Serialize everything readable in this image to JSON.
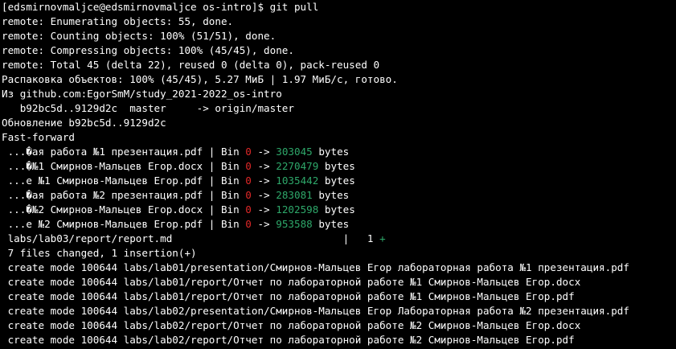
{
  "colors": {
    "background": "#000000",
    "text": "#ffffff",
    "removed": "#e02828",
    "added": "#2ea86a"
  },
  "prompt": {
    "text": "[edsmirnovmaljce@edsmirnovmaljce os-intro]$ ",
    "command": "git pull"
  },
  "output": [
    "remote: Enumerating objects: 55, done.",
    "remote: Counting objects: 100% (51/51), done.",
    "remote: Compressing objects: 100% (45/45), done.",
    "remote: Total 45 (delta 22), reused 0 (delta 0), pack-reused 0",
    "Распаковка объектов: 100% (45/45), 5.27 МиБ | 1.97 МиБ/с, готово.",
    "Из github.com:EgorSmM/study_2021-2022_os-intro",
    "   b92bc5d..9129d2c  master     -> origin/master",
    "Обновление b92bc5d..9129d2c",
    "Fast-forward"
  ],
  "binary_changes": [
    {
      "name": " ...�ая работа №1 презентация.pdf | Bin ",
      "from": "0",
      "arrow": " -> ",
      "to": "303045",
      "unit": " bytes"
    },
    {
      "name": " ...�№1 Смирнов-Мальцев Егор.docx | Bin ",
      "from": "0",
      "arrow": " -> ",
      "to": "2270479",
      "unit": " bytes"
    },
    {
      "name": " ...е №1 Смирнов-Мальцев Егор.pdf | Bin ",
      "from": "0",
      "arrow": " -> ",
      "to": "1035442",
      "unit": " bytes"
    },
    {
      "name": " ...�ая работа №2 презентация.pdf | Bin ",
      "from": "0",
      "arrow": " -> ",
      "to": "283081",
      "unit": " bytes"
    },
    {
      "name": " ...�№2 Смирнов-Мальцев Егор.docx | Bin ",
      "from": "0",
      "arrow": " -> ",
      "to": "1202598",
      "unit": " bytes"
    },
    {
      "name": " ...е №2 Смирнов-Мальцев Егор.pdf | Bin ",
      "from": "0",
      "arrow": " -> ",
      "to": "953588",
      "unit": " bytes"
    }
  ],
  "text_change": {
    "name": " labs/lab03/report/report.md                            |   1 ",
    "plus": "+"
  },
  "summary": " 7 files changed, 1 insertion(+)",
  "create_modes": [
    " create mode 100644 labs/lab01/presentation/Смирнов-Мальцев Егор лабораторная работа №1 презентация.pdf",
    " create mode 100644 labs/lab01/report/Отчет по лабораторной работе №1 Смирнов-Мальцев Егор.docx",
    " create mode 100644 labs/lab01/report/Отчет по лабораторной работе №1 Смирнов-Мальцев Егор.pdf",
    " create mode 100644 labs/lab02/presentation/Смирнов-Мальцев Егор Лабораторная работа №2 презентация.pdf",
    " create mode 100644 labs/lab02/report/Отчет по лабораторной работе №2 Смирнов-Мальцев Егор.docx",
    " create mode 100644 labs/lab02/report/Отчет по лабораторной работе №2 Смирнов-Мальцев Егор.pdf"
  ]
}
